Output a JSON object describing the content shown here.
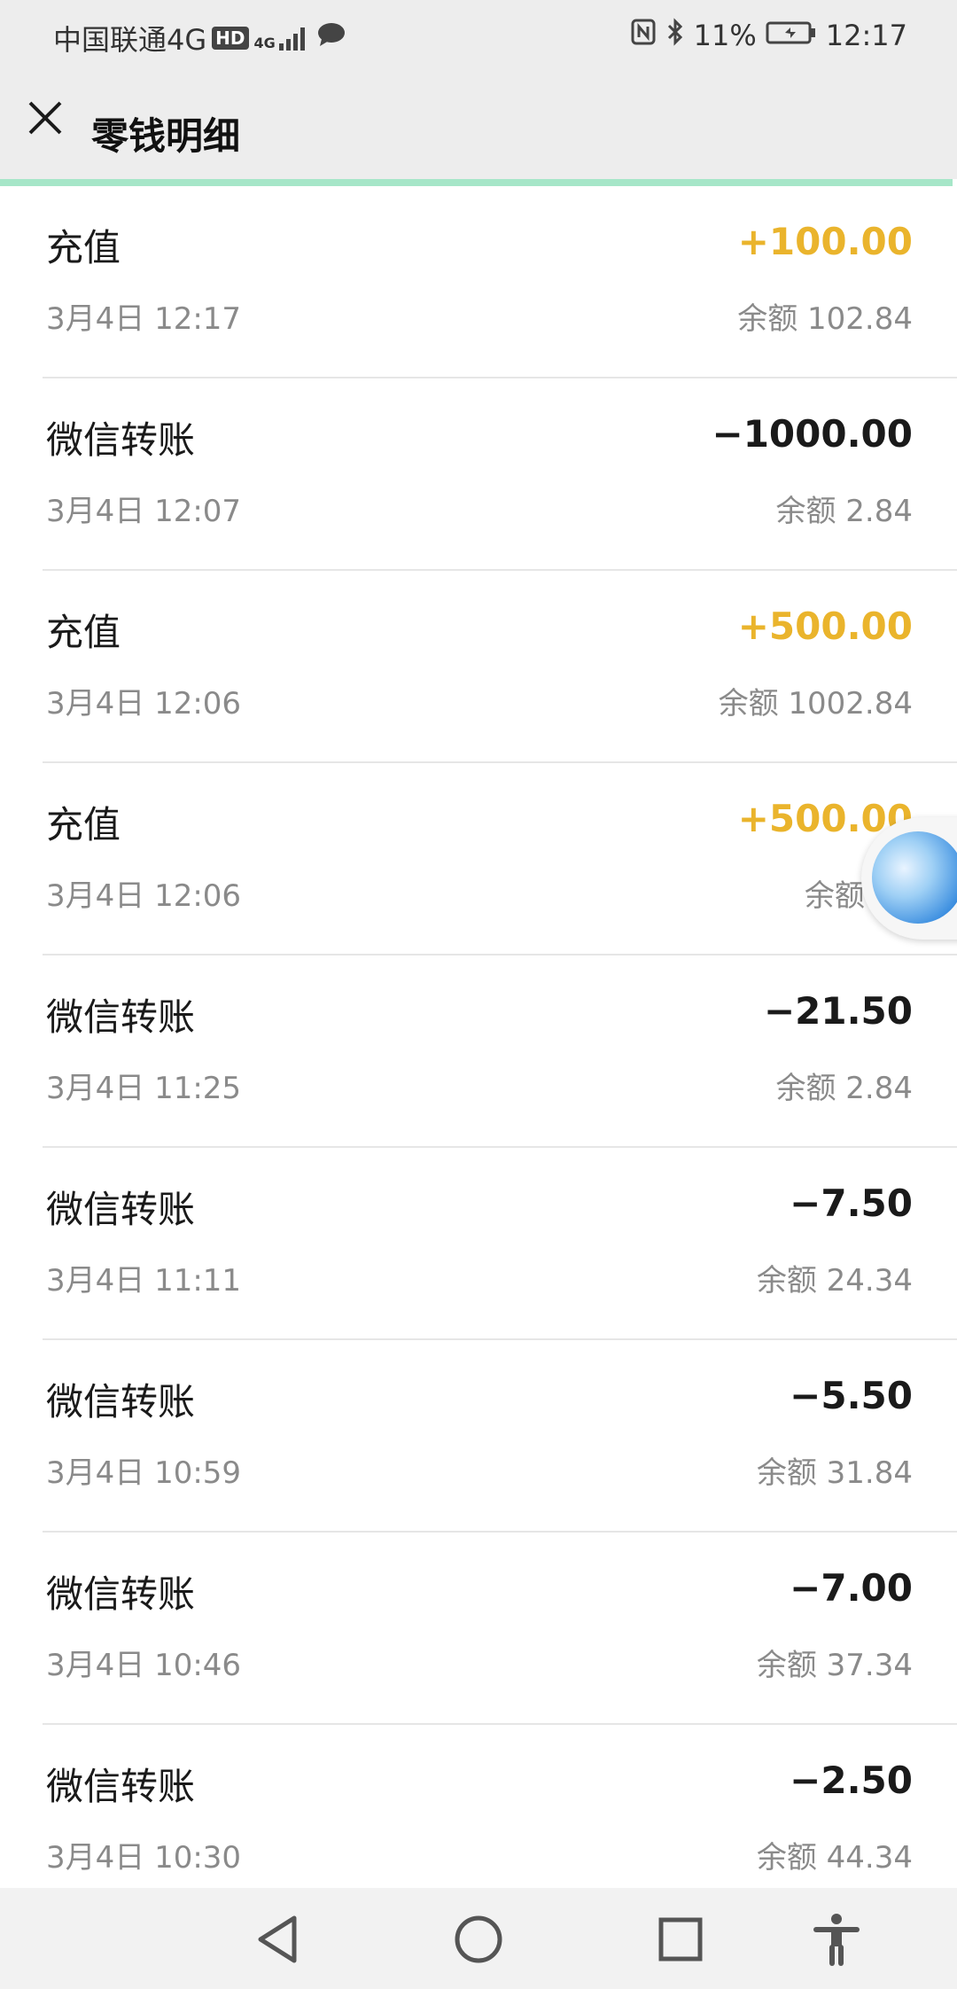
{
  "status_bar": {
    "carrier": "中国联通4G",
    "hd": "HD",
    "network": "4G",
    "battery": "11%",
    "time": "12:17"
  },
  "header": {
    "title": "零钱明细",
    "close_icon": "close-icon"
  },
  "transactions": [
    {
      "name": "充值",
      "time": "3月4日 12:17",
      "amount": "+100.00",
      "balance": "余额 102.84",
      "type": "income"
    },
    {
      "name": "微信转账",
      "time": "3月4日 12:07",
      "amount": "−1000.00",
      "balance": "余额 2.84",
      "type": "expense"
    },
    {
      "name": "充值",
      "time": "3月4日 12:06",
      "amount": "+500.00",
      "balance": "余额 1002.84",
      "type": "income"
    },
    {
      "name": "充值",
      "time": "3月4日 12:06",
      "amount": "+500.00",
      "balance": "余额 50",
      "type": "income"
    },
    {
      "name": "微信转账",
      "time": "3月4日 11:25",
      "amount": "−21.50",
      "balance": "余额 2.84",
      "type": "expense"
    },
    {
      "name": "微信转账",
      "time": "3月4日 11:11",
      "amount": "−7.50",
      "balance": "余额 24.34",
      "type": "expense"
    },
    {
      "name": "微信转账",
      "time": "3月4日 10:59",
      "amount": "−5.50",
      "balance": "余额 31.84",
      "type": "expense"
    },
    {
      "name": "微信转账",
      "time": "3月4日 10:46",
      "amount": "−7.00",
      "balance": "余额 37.34",
      "type": "expense"
    },
    {
      "name": "微信转账",
      "time": "3月4日 10:30",
      "amount": "−2.50",
      "balance": "余额 44.34",
      "type": "expense"
    }
  ],
  "colors": {
    "income": "#eab42c",
    "expense": "#1a1a1a",
    "progress": "#a6e6c8"
  },
  "progress": {
    "loaded_fraction": 0.995
  },
  "nav": {
    "back_icon": "back-triangle-icon",
    "home_icon": "home-circle-icon",
    "recents_icon": "recents-square-icon",
    "accessibility_icon": "accessibility-icon"
  }
}
